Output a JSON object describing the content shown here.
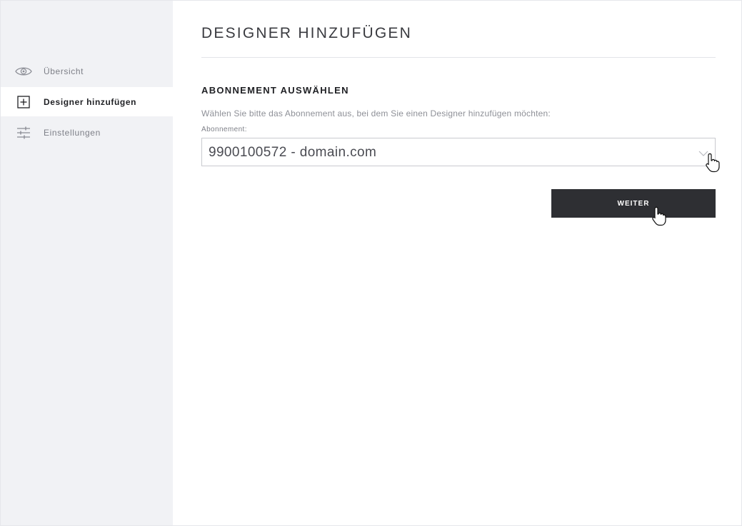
{
  "sidebar": {
    "items": [
      {
        "label": "Übersicht",
        "icon": "eye-icon",
        "active": false
      },
      {
        "label": "Designer hinzufügen",
        "icon": "plus-square-icon",
        "active": true
      },
      {
        "label": "Einstellungen",
        "icon": "sliders-icon",
        "active": false
      }
    ]
  },
  "main": {
    "title": "DESIGNER HINZUFÜGEN",
    "section_title": "ABONNEMENT AUSWÄHLEN",
    "description": "Wählen Sie bitte das Abonnement aus, bei dem Sie einen Designer hinzufügen möchten:",
    "subscription_field": {
      "label": "Abonnement:",
      "selected_value": "9900100572 - domain.com"
    },
    "continue_button_label": "WEITER"
  },
  "colors": {
    "sidebar_bg": "#f1f2f5",
    "button_bg": "#2e2f33",
    "active_text": "#1f2024"
  }
}
